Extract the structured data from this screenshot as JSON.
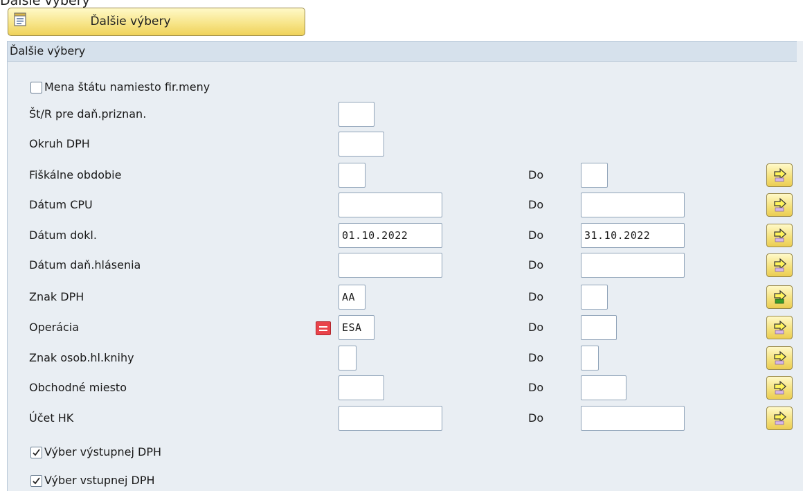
{
  "window_title": "Ďalšie výbery",
  "toolbar": {
    "button_label": "Ďalšie výbery",
    "button_icon": "document-selection-icon"
  },
  "section": {
    "title": "Ďalšie výbery",
    "checkbox_top": {
      "label": "Mena štátu namiesto fir.meny",
      "checked": false
    },
    "rows": [
      {
        "label": "Št/R pre daň.priznan.",
        "from": "",
        "to": null
      },
      {
        "label": "Okruh DPH",
        "from": "",
        "to": null
      },
      {
        "label": "Fiškálne obdobie",
        "from": "",
        "to_label": "Do",
        "to": "",
        "multiselect_state": "empty"
      },
      {
        "label": "Dátum CPU",
        "from": "",
        "to_label": "Do",
        "to": "",
        "multiselect_state": "empty"
      },
      {
        "label": "Dátum dokl.",
        "from": "01.10.2022",
        "to_label": "Do",
        "to": "31.10.2022",
        "multiselect_state": "empty"
      },
      {
        "label": "Dátum daň.hlásenia",
        "from": "",
        "to_label": "Do",
        "to": "",
        "multiselect_state": "empty"
      },
      {
        "label": "Znak DPH",
        "from": "AA",
        "to_label": "Do",
        "to": "",
        "multiselect_state": "active"
      },
      {
        "label": "Operácia",
        "from": "ESA",
        "to_label": "Do",
        "to": "",
        "multiselect_state": "empty",
        "operator_icon": "equals-icon"
      },
      {
        "label": "Znak osob.hl.knihy",
        "from": "",
        "to_label": "Do",
        "to": "",
        "multiselect_state": "empty"
      },
      {
        "label": "Obchodné miesto",
        "from": "",
        "to_label": "Do",
        "to": "",
        "multiselect_state": "empty"
      },
      {
        "label": "Účet HK",
        "from": "",
        "to_label": "Do",
        "to": "",
        "multiselect_state": "empty"
      }
    ],
    "checkbox_output": {
      "label": "Výber výstupnej DPH",
      "checked": true
    },
    "checkbox_input": {
      "label": "Výber vstupnej DPH",
      "checked": true
    }
  },
  "colors": {
    "panel_bg": "#e9eef3",
    "header_bg": "#d6e1ec",
    "button_yellow": "#f7e58a",
    "operator_red": "#e8434a",
    "active_green": "#3a9b2a"
  }
}
